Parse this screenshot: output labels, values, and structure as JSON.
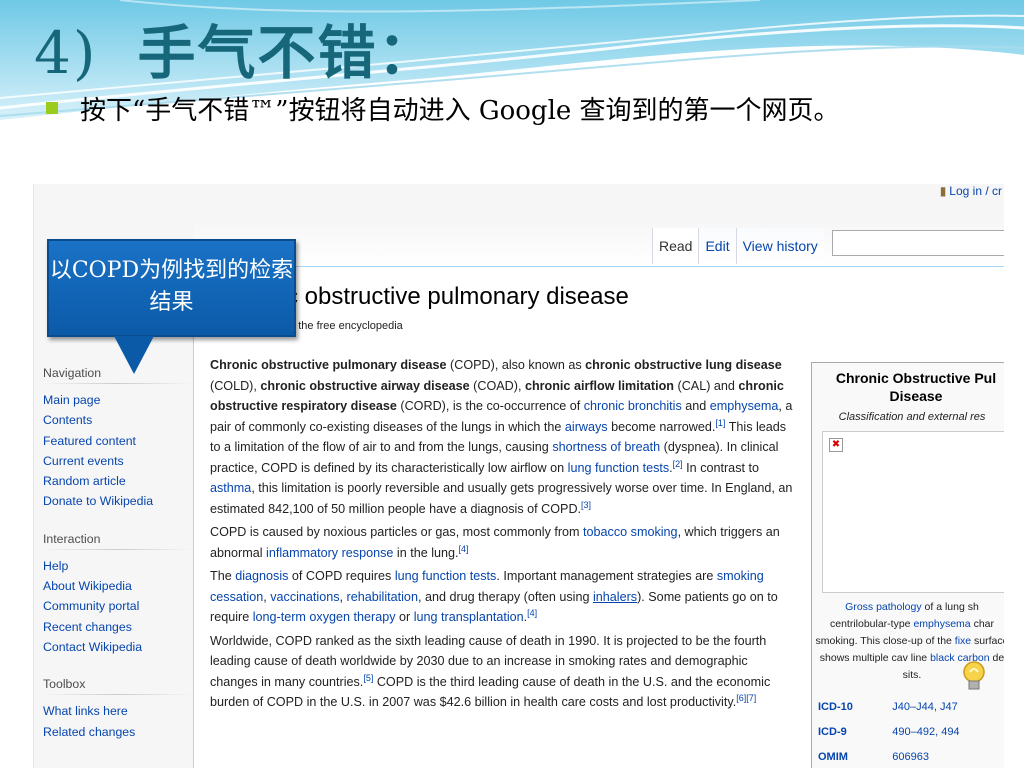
{
  "slide": {
    "title_num": "4)",
    "title_text": "手气不错：",
    "bullet": "按下“手气不错™”按钮将自动进入 Google 查询到的第一个网页。",
    "callout": "以COPD为例找到的检索结果",
    "colors": {
      "title": "#17677a",
      "bullet": "#9bcc1c",
      "callout": "#1565c0",
      "link": "#0645ad"
    }
  },
  "wiki": {
    "login": "Log in / cr",
    "tabs": [
      "Read",
      "Edit",
      "View history"
    ],
    "title": "c obstructive pulmonary disease",
    "tagline": "a, the free encyclopedia",
    "sidebar": {
      "navigation_heading": "Navigation",
      "navigation": [
        "Main page",
        "Contents",
        "Featured content",
        "Current events",
        "Random article",
        "Donate to Wikipedia"
      ],
      "interaction_heading": "Interaction",
      "interaction": [
        "Help",
        "About Wikipedia",
        "Community portal",
        "Recent changes",
        "Contact Wikipedia"
      ],
      "toolbox_heading": "Toolbox",
      "toolbox": [
        "What links here",
        "Related changes"
      ]
    },
    "paragraphs": [
      [
        {
          "b": "Chronic obstructive pulmonary disease"
        },
        {
          "t": " (COPD), also known as "
        },
        {
          "b": "chronic obstructive lung disease"
        },
        {
          "t": " (COLD), "
        },
        {
          "b": "chronic obstructive airway disease"
        },
        {
          "t": " (COAD), "
        },
        {
          "b": "chronic airflow limitation"
        },
        {
          "t": " (CAL) and "
        },
        {
          "b": "chronic obstructive respiratory disease"
        },
        {
          "t": " (CORD), is the co-occurrence of "
        },
        {
          "a": "chronic bronchitis"
        },
        {
          "t": " and "
        },
        {
          "a": "emphysema"
        },
        {
          "t": ", a pair of commonly co-existing diseases of the lungs in which the "
        },
        {
          "a": "airways"
        },
        {
          "t": " become narrowed."
        },
        {
          "s": "[1]"
        },
        {
          "t": " This leads to a limitation of the flow of air to and from the lungs, causing "
        },
        {
          "a": "shortness of breath"
        },
        {
          "t": " (dyspnea). In clinical practice, COPD is defined by its characteristically low airflow on "
        },
        {
          "a": "lung function tests"
        },
        {
          "t": "."
        },
        {
          "s": "[2]"
        },
        {
          "t": " In contrast to "
        },
        {
          "a": "asthma"
        },
        {
          "t": ", this limitation is poorly reversible and usually gets progressively worse over time. In England, an estimated 842,100 of 50 million people have a diagnosis of COPD."
        },
        {
          "s": "[3]"
        }
      ],
      [
        {
          "t": "COPD is caused by noxious particles or gas, most commonly from "
        },
        {
          "a": "tobacco smoking"
        },
        {
          "t": ", which triggers an abnormal "
        },
        {
          "a": "inflammatory response"
        },
        {
          "t": " in the lung."
        },
        {
          "s": "[4]"
        }
      ],
      [
        {
          "t": "The "
        },
        {
          "a": "diagnosis"
        },
        {
          "t": " of COPD requires "
        },
        {
          "a": "lung function tests"
        },
        {
          "t": ". Important management strategies are "
        },
        {
          "a": "smoking cessation"
        },
        {
          "t": ", "
        },
        {
          "a": "vaccinations"
        },
        {
          "t": ", "
        },
        {
          "a": "rehabilitation"
        },
        {
          "t": ", and drug therapy (often using "
        },
        {
          "u": "inhalers"
        },
        {
          "t": "). Some patients go on to require "
        },
        {
          "a": "long-term oxygen therapy"
        },
        {
          "t": " or "
        },
        {
          "a": "lung transplantation"
        },
        {
          "t": "."
        },
        {
          "s": "[4]"
        }
      ],
      [
        {
          "t": "Worldwide, COPD ranked as the sixth leading cause of death in 1990. It is projected to be the fourth leading cause of death worldwide by 2030 due to an increase in smoking rates and demographic changes in many countries."
        },
        {
          "s": "[5]"
        },
        {
          "t": " COPD is the third leading cause of death in the U.S. and the economic burden of COPD in the U.S. in 2007 was $42.6 billion in health care costs and lost productivity."
        },
        {
          "s": "[6][7]"
        }
      ]
    ],
    "infobox": {
      "title": "Chronic Obstructive Pul Disease",
      "subtitle": "Classification and external res",
      "caption": [
        {
          "a": "Gross pathology"
        },
        {
          "t": " of a lung sh centrilobular-type "
        },
        {
          "a": "emphysema"
        },
        {
          "t": " char smoking. This close-up of the "
        },
        {
          "a": "fixe"
        },
        {
          "t": " surface shows multiple cav line "
        },
        {
          "a": "black carbon"
        },
        {
          "t": " de sits."
        }
      ],
      "codes": [
        {
          "k": "ICD-10",
          "v": "J40–J44, J47"
        },
        {
          "k": "ICD-9",
          "v": "490–492, 494"
        },
        {
          "k": "OMIM",
          "v": "606963"
        }
      ]
    }
  }
}
